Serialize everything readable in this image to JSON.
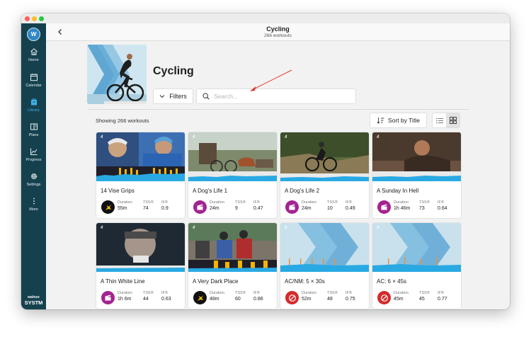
{
  "header": {
    "title": "Cycling",
    "subtitle": "266 workouts"
  },
  "user": {
    "initial": "W"
  },
  "sidebar": {
    "items": [
      {
        "label": "Home",
        "icon": "home-icon"
      },
      {
        "label": "Calendar",
        "icon": "calendar-icon"
      },
      {
        "label": "Library",
        "icon": "library-icon",
        "active": true
      },
      {
        "label": "Plans",
        "icon": "plans-icon"
      },
      {
        "label": "Progress",
        "icon": "progress-icon"
      },
      {
        "label": "Settings",
        "icon": "gear-icon"
      },
      {
        "label": "More",
        "icon": "more-icon"
      }
    ],
    "brand_line1": "wahoo",
    "brand_line2": "SYSTM"
  },
  "page": {
    "title": "Cycling"
  },
  "toolbar": {
    "filters_label": "Filters",
    "search_placeholder": "Search...",
    "showing_label": "Showing 266 workouts",
    "sort_label": "Sort by Title"
  },
  "stat_labels": {
    "duration": "Duration",
    "tss": "TSS®",
    "if": "IF®"
  },
  "workouts": [
    {
      "title": "14 Vise Grips",
      "duration": "55m",
      "tss": "74",
      "if": "0.9",
      "category_color": "#111111",
      "category_icon": "sufferfest-icon"
    },
    {
      "title": "A Dog's Life 1",
      "duration": "24m",
      "tss": "9",
      "if": "0.47",
      "category_color": "#a3248f",
      "category_icon": "clapper-icon"
    },
    {
      "title": "A Dog's Life 2",
      "duration": "24m",
      "tss": "10",
      "if": "0.49",
      "category_color": "#a3248f",
      "category_icon": "clapper-icon"
    },
    {
      "title": "A Sunday In Hell",
      "duration": "1h 46m",
      "tss": "73",
      "if": "0.64",
      "category_color": "#a3248f",
      "category_icon": "clapper-icon"
    },
    {
      "title": "A Thin White Line",
      "duration": "1h 6m",
      "tss": "44",
      "if": "0.63",
      "category_color": "#a3248f",
      "category_icon": "clapper-icon"
    },
    {
      "title": "A Very Dark Place",
      "duration": "48m",
      "tss": "60",
      "if": "0.86",
      "category_color": "#111111",
      "category_icon": "sufferfest-icon"
    },
    {
      "title": "AC/NM: 5 × 30s",
      "duration": "52m",
      "tss": "48",
      "if": "0.75",
      "category_color": "#d42a2a",
      "category_icon": "no-entry-icon"
    },
    {
      "title": "AC: 6 × 45s",
      "duration": "45m",
      "tss": "45",
      "if": "0.77",
      "category_color": "#d42a2a",
      "category_icon": "no-entry-icon"
    }
  ]
}
